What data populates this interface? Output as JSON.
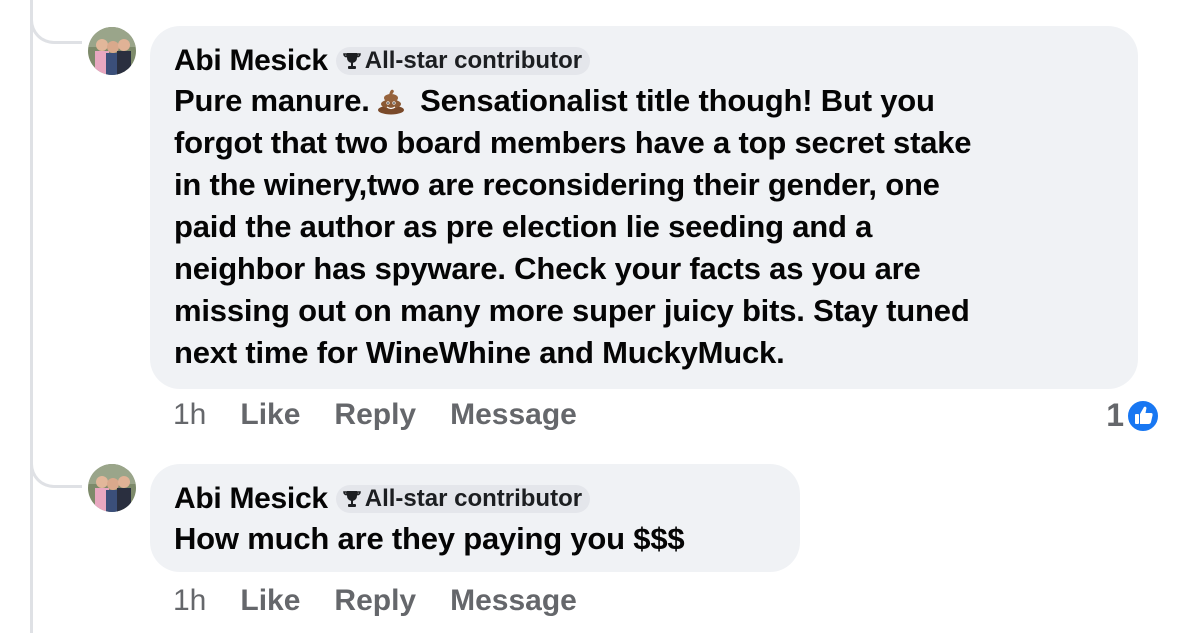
{
  "comments": [
    {
      "author": "Abi Mesick",
      "badge": "All-star contributor",
      "text_before_emoji": "Pure manure.",
      "emoji": "poop-emoji",
      "text_after_emoji": " Sensationalist title though! But you\nforgot that two board members have a top secret stake\nin the winery,two are reconsidering their gender, one\npaid the author as pre election lie seeding and a\nneighbor has spyware. Check your facts as you are\nmissing out on many more super juicy bits. Stay tuned\nnext time for WineWhine and MuckyMuck.",
      "time": "1h",
      "like_label": "Like",
      "reply_label": "Reply",
      "message_label": "Message",
      "reaction_count": "1",
      "reaction_icon": "like-reaction-icon"
    },
    {
      "author": "Abi Mesick",
      "badge": "All-star contributor",
      "text": "How much are they paying you $$$",
      "time": "1h",
      "like_label": "Like",
      "reply_label": "Reply",
      "message_label": "Message"
    }
  ],
  "colors": {
    "bubble": "#f0f2f5",
    "text": "#050505",
    "meta": "#65676b",
    "like_blue": "#1877f2",
    "thread_line": "#dfe1e5"
  }
}
